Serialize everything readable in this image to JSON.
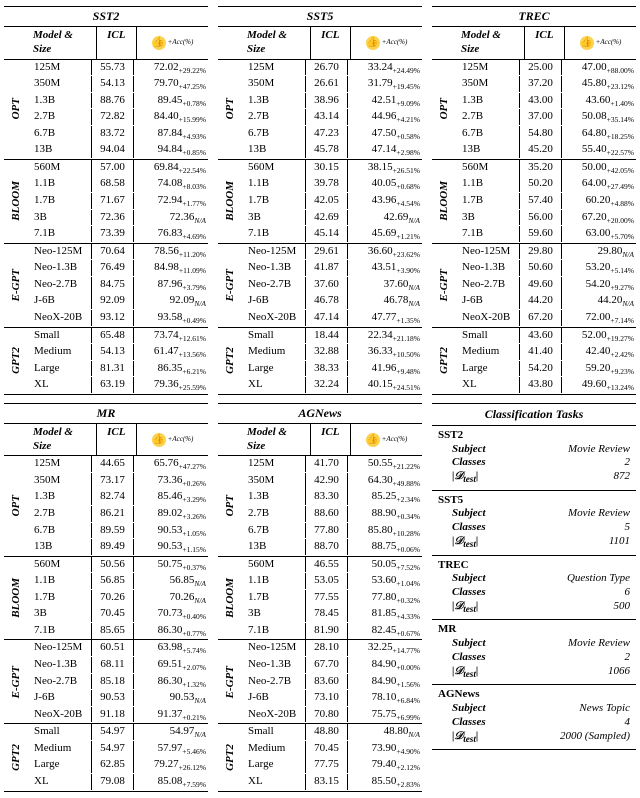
{
  "hdr": {
    "model_size": "Model & Size",
    "icl": "ICL",
    "gain_sub": "+Acc(%)"
  },
  "families": [
    "OPT",
    "BLOOM",
    "E-GPT",
    "GPT2"
  ],
  "opt_sizes": [
    "125M",
    "350M",
    "1.3B",
    "2.7B",
    "6.7B",
    "13B"
  ],
  "bloom_sizes": [
    "560M",
    "1.1B",
    "1.7B",
    "3B",
    "7.1B"
  ],
  "egpt_sizes": [
    "Neo-125M",
    "Neo-1.3B",
    "Neo-2.7B",
    "J-6B",
    "NeoX-20B"
  ],
  "gpt2_sizes": [
    "Small",
    "Medium",
    "Large",
    "XL"
  ],
  "tables": [
    {
      "name": "SST2",
      "gain_w": 74,
      "groups": [
        {
          "family": 0,
          "rows": [
            {
              "s": 0,
              "icl": "55.73",
              "v": "72.02",
              "d": "+29.22%"
            },
            {
              "s": 1,
              "icl": "54.13",
              "v": "79.70",
              "d": "+47.25%"
            },
            {
              "s": 2,
              "icl": "88.76",
              "v": "89.45",
              "d": "+0.78%"
            },
            {
              "s": 3,
              "icl": "72.82",
              "v": "84.40",
              "d": "+15.99%"
            },
            {
              "s": 4,
              "icl": "83.72",
              "v": "87.84",
              "d": "+4.93%"
            },
            {
              "s": 5,
              "icl": "94.04",
              "v": "94.84",
              "d": "+0.85%"
            }
          ]
        },
        {
          "family": 1,
          "rows": [
            {
              "s": 0,
              "icl": "57.00",
              "v": "69.84",
              "d": "+22.54%"
            },
            {
              "s": 1,
              "icl": "68.58",
              "v": "74.08",
              "d": "+8.03%"
            },
            {
              "s": 2,
              "icl": "71.67",
              "v": "72.94",
              "d": "+1.77%"
            },
            {
              "s": 3,
              "icl": "72.36",
              "v": "72.36",
              "d": "N/A"
            },
            {
              "s": 4,
              "icl": "73.39",
              "v": "76.83",
              "d": "+4.69%"
            }
          ]
        },
        {
          "family": 2,
          "rows": [
            {
              "s": 0,
              "icl": "70.64",
              "v": "78.56",
              "d": "+11.20%"
            },
            {
              "s": 1,
              "icl": "76.49",
              "v": "84.98",
              "d": "+11.09%"
            },
            {
              "s": 2,
              "icl": "84.75",
              "v": "87.96",
              "d": "+3.79%"
            },
            {
              "s": 3,
              "icl": "92.09",
              "v": "92.09",
              "d": "N/A"
            },
            {
              "s": 4,
              "icl": "93.12",
              "v": "93.58",
              "d": "+0.49%"
            }
          ]
        },
        {
          "family": 3,
          "rows": [
            {
              "s": 0,
              "icl": "65.48",
              "v": "73.74",
              "d": "+12.61%"
            },
            {
              "s": 1,
              "icl": "54.13",
              "v": "61.47",
              "d": "+13.56%"
            },
            {
              "s": 2,
              "icl": "81.31",
              "v": "86.35",
              "d": "+6.21%"
            },
            {
              "s": 3,
              "icl": "63.19",
              "v": "79.36",
              "d": "+25.59%"
            }
          ]
        }
      ]
    },
    {
      "name": "SST5",
      "gain_w": 74,
      "groups": [
        {
          "family": 0,
          "rows": [
            {
              "s": 0,
              "icl": "26.70",
              "v": "33.24",
              "d": "+24.49%"
            },
            {
              "s": 1,
              "icl": "26.61",
              "v": "31.79",
              "d": "+19.45%"
            },
            {
              "s": 2,
              "icl": "38.96",
              "v": "42.51",
              "d": "+9.09%"
            },
            {
              "s": 3,
              "icl": "43.14",
              "v": "44.96",
              "d": "+4.21%"
            },
            {
              "s": 4,
              "icl": "47.23",
              "v": "47.50",
              "d": "+0.58%"
            },
            {
              "s": 5,
              "icl": "45.78",
              "v": "47.14",
              "d": "+2.98%"
            }
          ]
        },
        {
          "family": 1,
          "rows": [
            {
              "s": 0,
              "icl": "30.15",
              "v": "38.15",
              "d": "+26.51%"
            },
            {
              "s": 1,
              "icl": "39.78",
              "v": "40.05",
              "d": "+0.68%"
            },
            {
              "s": 2,
              "icl": "42.05",
              "v": "43.96",
              "d": "+4.54%"
            },
            {
              "s": 3,
              "icl": "42.69",
              "v": "42.69",
              "d": "N/A"
            },
            {
              "s": 4,
              "icl": "45.14",
              "v": "45.69",
              "d": "+1.21%"
            }
          ]
        },
        {
          "family": 2,
          "rows": [
            {
              "s": 0,
              "icl": "29.61",
              "v": "36.60",
              "d": "+23.62%"
            },
            {
              "s": 1,
              "icl": "41.87",
              "v": "43.51",
              "d": "+3.90%"
            },
            {
              "s": 2,
              "icl": "37.60",
              "v": "37.60",
              "d": "N/A"
            },
            {
              "s": 3,
              "icl": "46.78",
              "v": "46.78",
              "d": "N/A"
            },
            {
              "s": 4,
              "icl": "47.14",
              "v": "47.77",
              "d": "+1.35%"
            }
          ]
        },
        {
          "family": 3,
          "rows": [
            {
              "s": 0,
              "icl": "18.44",
              "v": "22.34",
              "d": "+21.18%"
            },
            {
              "s": 1,
              "icl": "32.88",
              "v": "36.33",
              "d": "+10.50%"
            },
            {
              "s": 2,
              "icl": "38.33",
              "v": "41.96",
              "d": "+9.48%"
            },
            {
              "s": 3,
              "icl": "32.24",
              "v": "40.15",
              "d": "+24.51%"
            }
          ]
        }
      ]
    },
    {
      "name": "TREC",
      "gain_w": 74,
      "groups": [
        {
          "family": 0,
          "rows": [
            {
              "s": 0,
              "icl": "25.00",
              "v": "47.00",
              "d": "+88.00%"
            },
            {
              "s": 1,
              "icl": "37.20",
              "v": "45.80",
              "d": "+23.12%"
            },
            {
              "s": 2,
              "icl": "43.00",
              "v": "43.60",
              "d": "+1.40%"
            },
            {
              "s": 3,
              "icl": "37.00",
              "v": "50.08",
              "d": "+35.14%"
            },
            {
              "s": 4,
              "icl": "54.80",
              "v": "64.80",
              "d": "+18.25%"
            },
            {
              "s": 5,
              "icl": "45.20",
              "v": "55.40",
              "d": "+22.57%"
            }
          ]
        },
        {
          "family": 1,
          "rows": [
            {
              "s": 0,
              "icl": "35.20",
              "v": "50.00",
              "d": "+42.05%"
            },
            {
              "s": 1,
              "icl": "50.20",
              "v": "64.00",
              "d": "+27.49%"
            },
            {
              "s": 2,
              "icl": "57.40",
              "v": "60.20",
              "d": "+4.88%"
            },
            {
              "s": 3,
              "icl": "56.00",
              "v": "67.20",
              "d": "+20.00%"
            },
            {
              "s": 4,
              "icl": "59.60",
              "v": "63.00",
              "d": "+5.70%"
            }
          ]
        },
        {
          "family": 2,
          "rows": [
            {
              "s": 0,
              "icl": "29.80",
              "v": "29.80",
              "d": "N/A"
            },
            {
              "s": 1,
              "icl": "50.60",
              "v": "53.20",
              "d": "+5.14%"
            },
            {
              "s": 2,
              "icl": "49.60",
              "v": "54.20",
              "d": "+9.27%"
            },
            {
              "s": 3,
              "icl": "44.20",
              "v": "44.20",
              "d": "N/A"
            },
            {
              "s": 4,
              "icl": "67.20",
              "v": "72.00",
              "d": "+7.14%"
            }
          ]
        },
        {
          "family": 3,
          "rows": [
            {
              "s": 0,
              "icl": "43.60",
              "v": "52.00",
              "d": "+19.27%"
            },
            {
              "s": 1,
              "icl": "41.40",
              "v": "42.40",
              "d": "+2.42%"
            },
            {
              "s": 2,
              "icl": "54.20",
              "v": "59.20",
              "d": "+9.23%"
            },
            {
              "s": 3,
              "icl": "43.80",
              "v": "49.60",
              "d": "+13.24%"
            }
          ]
        }
      ]
    },
    {
      "name": "MR",
      "gain_w": 74,
      "groups": [
        {
          "family": 0,
          "rows": [
            {
              "s": 0,
              "icl": "44.65",
              "v": "65.76",
              "d": "+47.27%"
            },
            {
              "s": 1,
              "icl": "73.17",
              "v": "73.36",
              "d": "+0.26%"
            },
            {
              "s": 2,
              "icl": "82.74",
              "v": "85.46",
              "d": "+3.29%"
            },
            {
              "s": 3,
              "icl": "86.21",
              "v": "89.02",
              "d": "+3.26%"
            },
            {
              "s": 4,
              "icl": "89.59",
              "v": "90.53",
              "d": "+1.05%"
            },
            {
              "s": 5,
              "icl": "89.49",
              "v": "90.53",
              "d": "+1.15%"
            }
          ]
        },
        {
          "family": 1,
          "rows": [
            {
              "s": 0,
              "icl": "50.56",
              "v": "50.75",
              "d": "+0.37%"
            },
            {
              "s": 1,
              "icl": "56.85",
              "v": "56.85",
              "d": "N/A"
            },
            {
              "s": 2,
              "icl": "70.26",
              "v": "70.26",
              "d": "N/A"
            },
            {
              "s": 3,
              "icl": "70.45",
              "v": "70.73",
              "d": "+0.40%"
            },
            {
              "s": 4,
              "icl": "85.65",
              "v": "86.30",
              "d": "+0.77%"
            }
          ]
        },
        {
          "family": 2,
          "rows": [
            {
              "s": 0,
              "icl": "60.51",
              "v": "63.98",
              "d": "+5.74%"
            },
            {
              "s": 1,
              "icl": "68.11",
              "v": "69.51",
              "d": "+2.07%"
            },
            {
              "s": 2,
              "icl": "85.18",
              "v": "86.30",
              "d": "+1.32%"
            },
            {
              "s": 3,
              "icl": "90.53",
              "v": "90.53",
              "d": "N/A"
            },
            {
              "s": 4,
              "icl": "91.18",
              "v": "91.37",
              "d": "+0.21%"
            }
          ]
        },
        {
          "family": 3,
          "rows": [
            {
              "s": 0,
              "icl": "54.97",
              "v": "54.97",
              "d": "N/A"
            },
            {
              "s": 1,
              "icl": "54.97",
              "v": "57.97",
              "d": "+5.46%"
            },
            {
              "s": 2,
              "icl": "62.85",
              "v": "79.27",
              "d": "+26.12%"
            },
            {
              "s": 3,
              "icl": "79.08",
              "v": "85.08",
              "d": "+7.59%"
            }
          ]
        }
      ]
    },
    {
      "name": "AGNews",
      "gain_w": 74,
      "groups": [
        {
          "family": 0,
          "rows": [
            {
              "s": 0,
              "icl": "41.70",
              "v": "50.55",
              "d": "+21.22%"
            },
            {
              "s": 1,
              "icl": "42.90",
              "v": "64.30",
              "d": "+49.88%"
            },
            {
              "s": 2,
              "icl": "83.30",
              "v": "85.25",
              "d": "+2.34%"
            },
            {
              "s": 3,
              "icl": "88.60",
              "v": "88.90",
              "d": "+0.34%"
            },
            {
              "s": 4,
              "icl": "77.80",
              "v": "85.80",
              "d": "+10.28%"
            },
            {
              "s": 5,
              "icl": "88.70",
              "v": "88.75",
              "d": "+0.06%"
            }
          ]
        },
        {
          "family": 1,
          "rows": [
            {
              "s": 0,
              "icl": "46.55",
              "v": "50.05",
              "d": "+7.52%"
            },
            {
              "s": 1,
              "icl": "53.05",
              "v": "53.60",
              "d": "+1.04%"
            },
            {
              "s": 2,
              "icl": "77.55",
              "v": "77.80",
              "d": "+0.32%"
            },
            {
              "s": 3,
              "icl": "78.45",
              "v": "81.85",
              "d": "+4.33%"
            },
            {
              "s": 4,
              "icl": "81.90",
              "v": "82.45",
              "d": "+0.67%"
            }
          ]
        },
        {
          "family": 2,
          "rows": [
            {
              "s": 0,
              "icl": "28.10",
              "v": "32.25",
              "d": "+14.77%"
            },
            {
              "s": 1,
              "icl": "67.70",
              "v": "84.90",
              "d": "+0.00%"
            },
            {
              "s": 2,
              "icl": "83.60",
              "v": "84.90",
              "d": "+1.56%"
            },
            {
              "s": 3,
              "icl": "73.10",
              "v": "78.10",
              "d": "+6.84%"
            },
            {
              "s": 4,
              "icl": "70.80",
              "v": "75.75",
              "d": "+6.99%"
            }
          ]
        },
        {
          "family": 3,
          "rows": [
            {
              "s": 0,
              "icl": "48.80",
              "v": "48.80",
              "d": "N/A"
            },
            {
              "s": 1,
              "icl": "70.45",
              "v": "73.90",
              "d": "+4.90%"
            },
            {
              "s": 2,
              "icl": "77.75",
              "v": "79.40",
              "d": "+2.12%"
            },
            {
              "s": 3,
              "icl": "83.15",
              "v": "85.50",
              "d": "+2.83%"
            }
          ]
        }
      ]
    }
  ],
  "cls": {
    "title": "Classification Tasks",
    "keys": {
      "subject": "Subject",
      "classes": "Classes",
      "dtest": "|𝒟_test|"
    },
    "tasks": [
      {
        "name": "SST2",
        "subject": "Movie Review",
        "classes": "2",
        "dtest": "872"
      },
      {
        "name": "SST5",
        "subject": "Movie Review",
        "classes": "5",
        "dtest": "1101"
      },
      {
        "name": "TREC",
        "subject": "Question Type",
        "classes": "6",
        "dtest": "500"
      },
      {
        "name": "MR",
        "subject": "Movie Review",
        "classes": "2",
        "dtest": "1066"
      },
      {
        "name": "AGNews",
        "subject": "News Topic",
        "classes": "4",
        "dtest": "2000 (Sampled)"
      }
    ]
  }
}
